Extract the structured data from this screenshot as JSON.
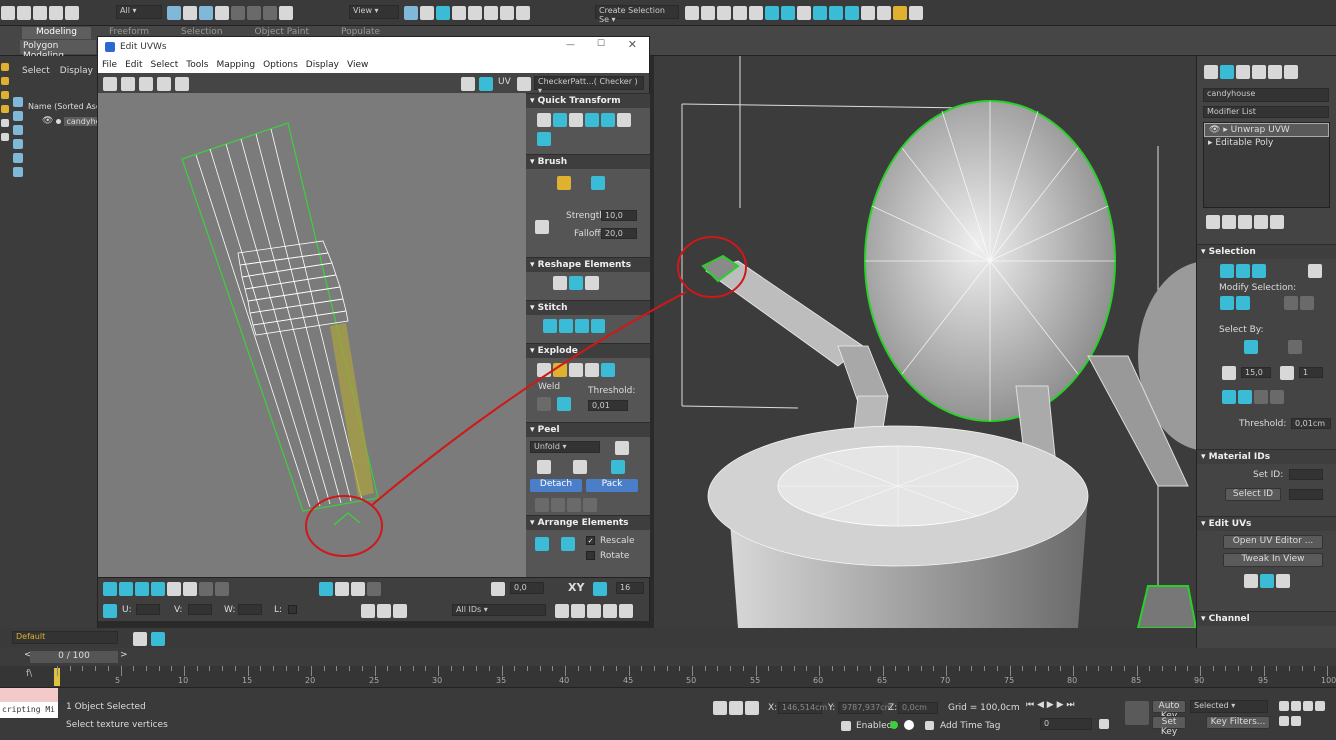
{
  "toolbar": {
    "selection_filter": "All",
    "view_dropdown": "View",
    "create_selection_set": "Create Selection Se"
  },
  "ribbon": {
    "tabs": [
      "Modeling",
      "Freeform",
      "Selection",
      "Object Paint",
      "Populate"
    ],
    "sub_label": "Polygon Modeling"
  },
  "scene": {
    "select_label": "Select",
    "display_label": "Display",
    "column_header": "Name (Sorted Ascen",
    "object_name": "candyho"
  },
  "uv_window": {
    "title": "Edit UVWs",
    "menu": [
      "File",
      "Edit",
      "Select",
      "Tools",
      "Mapping",
      "Options",
      "Display",
      "View"
    ],
    "uv_label": "UV",
    "checker": "CheckerPatt...( Checker )"
  },
  "rollouts": {
    "quick_transform": "Quick Transform",
    "brush": "Brush",
    "strength_label": "Strength:",
    "strength_value": "10,0",
    "falloff_label": "Falloff:",
    "falloff_value": "20,0",
    "reshape": "Reshape Elements",
    "stitch": "Stitch",
    "explode": "Explode",
    "weld": "Weld",
    "threshold_label": "Threshold:",
    "threshold_value": "0,01",
    "peel": "Peel",
    "unfold": "Unfold",
    "detach": "Detach",
    "pack": "Pack",
    "arrange": "Arrange Elements",
    "rescale": "Rescale",
    "rotate": "Rotate"
  },
  "uv_bottom": {
    "value_a": "0,0",
    "xy": "XY",
    "num_16": "16",
    "u": "U:",
    "v": "V:",
    "w": "W:",
    "l": "L:",
    "ids": "All IDs"
  },
  "cmd": {
    "object": "candyhouse",
    "modifier_list": "Modifier List",
    "stack": [
      "Unwrap UVW",
      "Editable Poly"
    ],
    "selection": "Selection",
    "modify_selection": "Modify Selection:",
    "select_by": "Select By:",
    "angle": "15,0",
    "num1": "1",
    "threshold": "Threshold:",
    "threshold_value": "0,01cm",
    "material_ids": "Material IDs",
    "set_id": "Set ID:",
    "select_id": "Select ID",
    "edit_uvs": "Edit UVs",
    "open_uv": "Open UV Editor ...",
    "tweak": "Tweak In View",
    "channel": "Channel"
  },
  "layer": "Default",
  "timeline": {
    "frame": "0 / 100",
    "ticks": [
      "5",
      "10",
      "15",
      "20",
      "25",
      "30",
      "35",
      "40",
      "45",
      "50",
      "55",
      "60",
      "65",
      "70",
      "75",
      "80",
      "85",
      "90",
      "95",
      "100"
    ]
  },
  "status": {
    "script": "cripting Mi",
    "objects": "1 Object Selected",
    "prompt": "Select texture vertices",
    "x_label": "X:",
    "x": "146,514cm",
    "y_label": "Y:",
    "y": "9787,937cm",
    "z_label": "Z:",
    "z": "0,0cm",
    "grid": "Grid = 100,0cm",
    "enabled": "Enabled:",
    "add_time_tag": "Add Time Tag",
    "auto_key": "Auto Key",
    "selected": "Selected",
    "set_key": "Set Key",
    "key_filters": "Key Filters...",
    "frame_field": "0"
  }
}
